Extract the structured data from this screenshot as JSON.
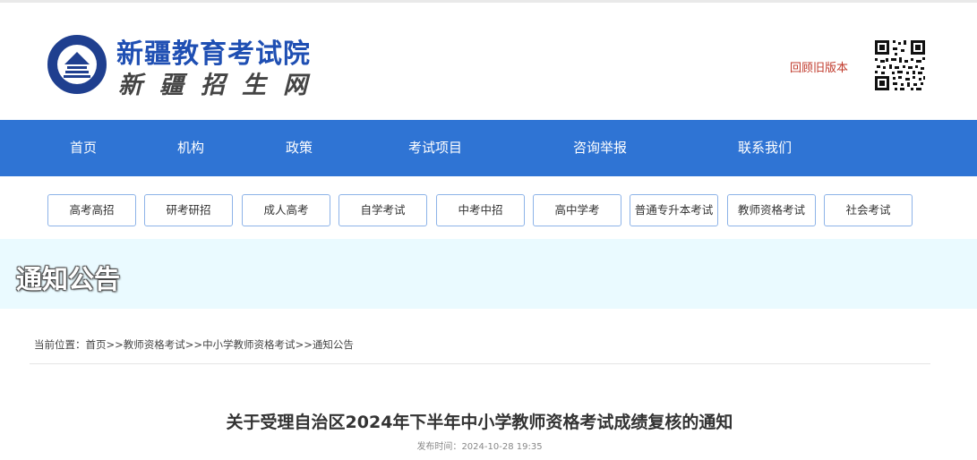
{
  "header": {
    "site_name": "新疆教育考试院",
    "site_subtitle": "新疆招生网",
    "old_version_link": "回顾旧版本"
  },
  "nav": {
    "items": [
      {
        "label": "首页"
      },
      {
        "label": "机构"
      },
      {
        "label": "政策"
      },
      {
        "label": "考试项目"
      },
      {
        "label": "咨询举报"
      },
      {
        "label": "联系我们"
      }
    ]
  },
  "categories": [
    {
      "label": "高考高招"
    },
    {
      "label": "研考研招"
    },
    {
      "label": "成人高考"
    },
    {
      "label": "自学考试"
    },
    {
      "label": "中考中招"
    },
    {
      "label": "高中学考"
    },
    {
      "label": "普通专升本考试"
    },
    {
      "label": "教师资格考试"
    },
    {
      "label": "社会考试"
    }
  ],
  "banner": {
    "title": "通知公告"
  },
  "breadcrumb": {
    "prefix": "当前位置：",
    "items": [
      "首页",
      "教师资格考试",
      "中小学教师资格考试",
      "通知公告"
    ],
    "separator": ">>"
  },
  "article": {
    "title": "关于受理自治区2024年下半年中小学教师资格考试成绩复核的通知",
    "publish_label": "发布时间：",
    "publish_time": "2024-10-28 19:35"
  },
  "colors": {
    "nav_bg": "#2f74d4",
    "brand_blue": "#1f4fb3",
    "banner_bg": "#eafaff",
    "old_version_red": "#c0392b"
  }
}
